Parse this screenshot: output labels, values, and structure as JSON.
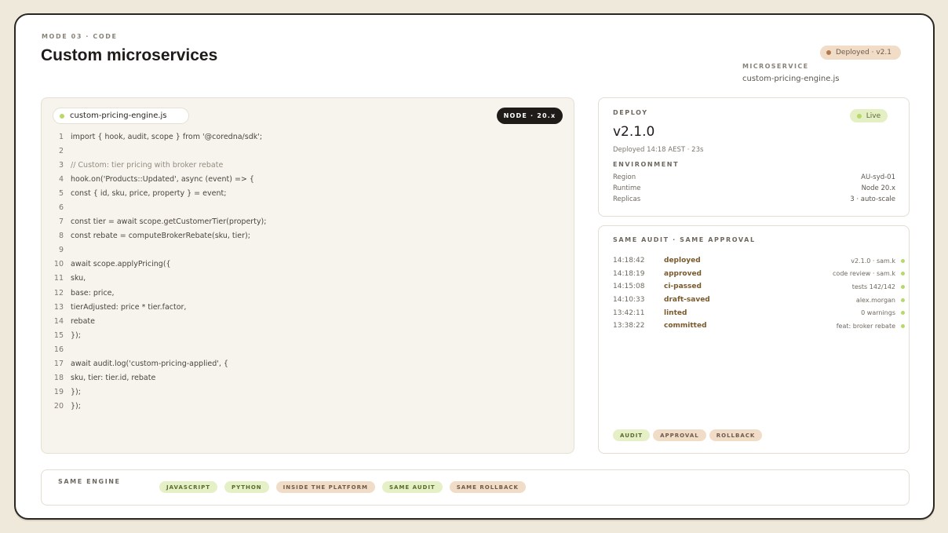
{
  "header": {
    "eyebrow": "MODE 03 · CODE",
    "title": "Custom microservices",
    "status_pill": "Deployed · v2.1",
    "microservice_label": "MICROSERVICE",
    "microservice_value": "custom-pricing-engine.js"
  },
  "editor": {
    "file_name": "custom-pricing-engine.js",
    "runtime_badge": "NODE · 20.x",
    "lines": [
      {
        "n": "1",
        "text": "import { hook, audit, scope } from '@coredna/sdk';",
        "type": "code"
      },
      {
        "n": "2",
        "text": "",
        "type": "code"
      },
      {
        "n": "3",
        "text": "// Custom: tier pricing with broker rebate",
        "type": "comment"
      },
      {
        "n": "4",
        "text": "hook.on('Products::Updated', async (event) => {",
        "type": "code"
      },
      {
        "n": "5",
        "text": "const { id, sku, price, property } = event;",
        "type": "code"
      },
      {
        "n": "6",
        "text": "",
        "type": "code"
      },
      {
        "n": "7",
        "text": "const tier = await scope.getCustomerTier(property);",
        "type": "code"
      },
      {
        "n": "8",
        "text": "const rebate = computeBrokerRebate(sku, tier);",
        "type": "code"
      },
      {
        "n": "9",
        "text": "",
        "type": "code"
      },
      {
        "n": "10",
        "text": "await scope.applyPricing({",
        "type": "code"
      },
      {
        "n": "11",
        "text": "sku,",
        "type": "code"
      },
      {
        "n": "12",
        "text": "base: price,",
        "type": "code"
      },
      {
        "n": "13",
        "text": "tierAdjusted: price * tier.factor,",
        "type": "code"
      },
      {
        "n": "14",
        "text": "rebate",
        "type": "code"
      },
      {
        "n": "15",
        "text": "});",
        "type": "code"
      },
      {
        "n": "16",
        "text": "",
        "type": "code"
      },
      {
        "n": "17",
        "text": "await audit.log('custom-pricing-applied', {",
        "type": "code"
      },
      {
        "n": "18",
        "text": "sku, tier: tier.id, rebate",
        "type": "code"
      },
      {
        "n": "19",
        "text": "});",
        "type": "code"
      },
      {
        "n": "20",
        "text": "});",
        "type": "code"
      }
    ]
  },
  "deploy": {
    "label": "DEPLOY",
    "status": "Live",
    "version": "v2.1.0",
    "meta": "Deployed 14:18 AEST · 23s",
    "env_label": "ENVIRONMENT",
    "env": [
      {
        "key": "Region",
        "value": "AU-syd-01"
      },
      {
        "key": "Runtime",
        "value": "Node 20.x"
      },
      {
        "key": "Replicas",
        "value": "3 · auto-scale"
      }
    ]
  },
  "audit": {
    "label": "SAME AUDIT · SAME APPROVAL",
    "events": [
      {
        "time": "14:18:42",
        "event": "deployed",
        "detail": "v2.1.0 · sam.k"
      },
      {
        "time": "14:18:19",
        "event": "approved",
        "detail": "code review · sam.k"
      },
      {
        "time": "14:15:08",
        "event": "ci-passed",
        "detail": "tests 142/142"
      },
      {
        "time": "14:10:33",
        "event": "draft-saved",
        "detail": "alex.morgan"
      },
      {
        "time": "13:42:11",
        "event": "linted",
        "detail": "0 warnings"
      },
      {
        "time": "13:38:22",
        "event": "committed",
        "detail": "feat: broker rebate"
      }
    ],
    "tags": [
      "AUDIT",
      "APPROVAL",
      "ROLLBACK"
    ]
  },
  "engine": {
    "label": "SAME ENGINE",
    "tags": [
      "JAVASCRIPT",
      "PYTHON",
      "INSIDE THE PLATFORM",
      "SAME AUDIT",
      "SAME ROLLBACK"
    ]
  },
  "colors": {
    "background": "#efe9dc",
    "accent_green": "#b8d86a",
    "accent_brown": "#b2794d",
    "event_text": "#7a5a2c"
  }
}
